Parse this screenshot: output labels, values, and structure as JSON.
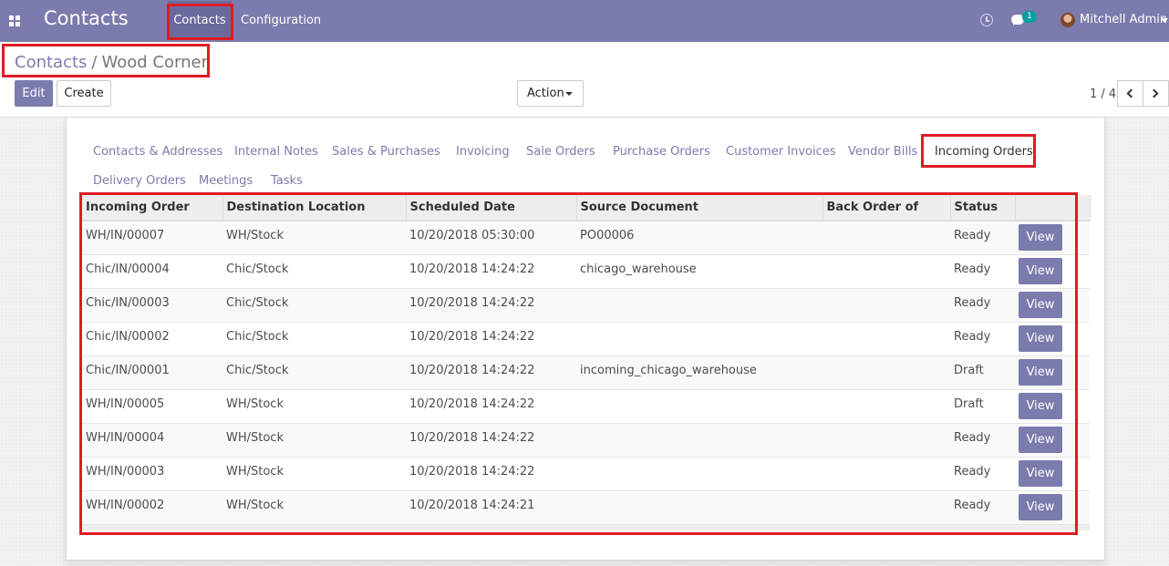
{
  "navbar": {
    "app_title": "Contacts",
    "menu_contacts": "Contacts",
    "menu_configuration": "Configuration",
    "chat_badge": "1",
    "user_name": "Mitchell Admin"
  },
  "breadcrumb": {
    "parent": "Contacts",
    "separator": "/",
    "current": "Wood Corner"
  },
  "buttons": {
    "edit": "Edit",
    "create": "Create",
    "action": "Action"
  },
  "pager": {
    "value": "1 / 4"
  },
  "tabs": [
    {
      "label": "Contacts & Addresses"
    },
    {
      "label": "Internal Notes"
    },
    {
      "label": "Sales & Purchases"
    },
    {
      "label": "Invoicing"
    },
    {
      "label": "Sale Orders"
    },
    {
      "label": "Purchase Orders"
    },
    {
      "label": "Customer Invoices"
    },
    {
      "label": "Vendor Bills"
    },
    {
      "label": "Incoming Orders"
    },
    {
      "label": "Delivery Orders"
    },
    {
      "label": "Meetings"
    },
    {
      "label": "Tasks"
    }
  ],
  "table": {
    "headers": [
      "Incoming Order",
      "Destination Location",
      "Scheduled Date",
      "Source Document",
      "Back Order of",
      "Status",
      ""
    ],
    "view_label": "View",
    "rows": [
      {
        "order": "WH/IN/00007",
        "location": "WH/Stock",
        "date": "10/20/2018 05:30:00",
        "source": "PO00006",
        "backorder": "",
        "status": "Ready"
      },
      {
        "order": "Chic/IN/00004",
        "location": "Chic/Stock",
        "date": "10/20/2018 14:24:22",
        "source": "chicago_warehouse",
        "backorder": "",
        "status": "Ready"
      },
      {
        "order": "Chic/IN/00003",
        "location": "Chic/Stock",
        "date": "10/20/2018 14:24:22",
        "source": "",
        "backorder": "",
        "status": "Ready"
      },
      {
        "order": "Chic/IN/00002",
        "location": "Chic/Stock",
        "date": "10/20/2018 14:24:22",
        "source": "",
        "backorder": "",
        "status": "Ready"
      },
      {
        "order": "Chic/IN/00001",
        "location": "Chic/Stock",
        "date": "10/20/2018 14:24:22",
        "source": "incoming_chicago_warehouse",
        "backorder": "",
        "status": "Draft"
      },
      {
        "order": "WH/IN/00005",
        "location": "WH/Stock",
        "date": "10/20/2018 14:24:22",
        "source": "",
        "backorder": "",
        "status": "Draft"
      },
      {
        "order": "WH/IN/00004",
        "location": "WH/Stock",
        "date": "10/20/2018 14:24:22",
        "source": "",
        "backorder": "",
        "status": "Ready"
      },
      {
        "order": "WH/IN/00003",
        "location": "WH/Stock",
        "date": "10/20/2018 14:24:22",
        "source": "",
        "backorder": "",
        "status": "Ready"
      },
      {
        "order": "WH/IN/00002",
        "location": "WH/Stock",
        "date": "10/20/2018 14:24:21",
        "source": "",
        "backorder": "",
        "status": "Ready"
      }
    ]
  },
  "colors": {
    "brand": "#7c7bad",
    "highlight": "#e01b24",
    "badge": "#00a09d"
  }
}
